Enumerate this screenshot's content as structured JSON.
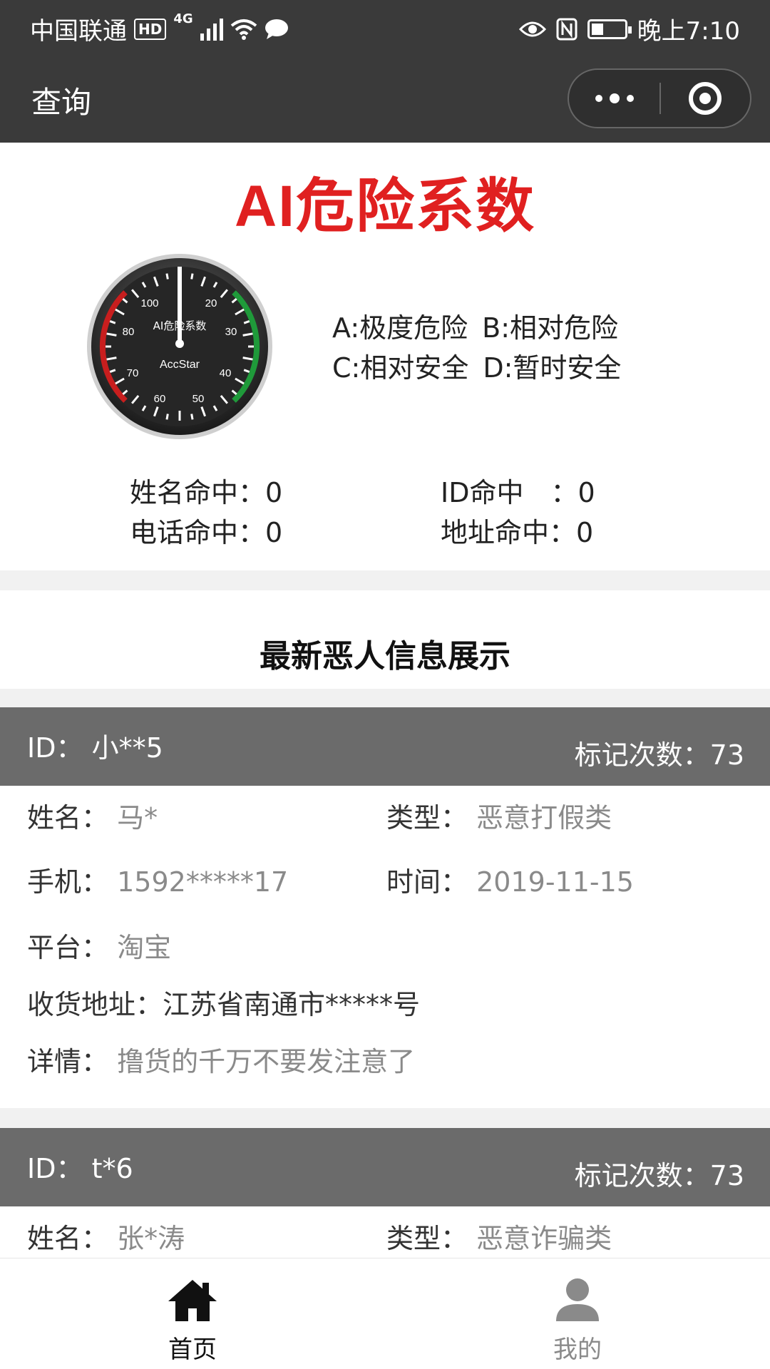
{
  "status": {
    "carrier": "中国联通",
    "hd": "HD",
    "network": "4G",
    "time": "晚上7:10"
  },
  "nav": {
    "title": "查询"
  },
  "danger": {
    "title": "AI危险系数",
    "gauge": {
      "label_top": "AI危险系数",
      "label_bottom": "AccStar",
      "ticks": [
        "100",
        "20",
        "80",
        "30",
        "70",
        "40",
        "60",
        "50"
      ]
    },
    "legend": {
      "a": "A:极度危险",
      "b": "B:相对危险",
      "c": "C:相对安全",
      "d": "D:暂时安全"
    }
  },
  "hits": {
    "name": "姓名命中：0",
    "id": "ID命中　：0",
    "phone": "电话命中：0",
    "address": "地址命中：0"
  },
  "section_title": "最新恶人信息展示",
  "records": [
    {
      "id_label": "ID：",
      "id": "小**5",
      "count_label": "标记次数：",
      "count": "73",
      "name_label": "姓名：",
      "name": "马*",
      "type_label": "类型：",
      "type": "恶意打假类",
      "phone_label": "手机：",
      "phone": "1592*****17",
      "time_label": "时间：",
      "time": "2019-11-15",
      "platform_label": "平台：",
      "platform": "淘宝",
      "address_label": "收货地址：",
      "address": "江苏省南通市*****号",
      "detail_label": "详情：",
      "detail": "撸货的千万不要发注意了"
    },
    {
      "id_label": "ID：",
      "id": "t*6",
      "count_label": "标记次数：",
      "count": "73",
      "name_label": "姓名：",
      "name": "张*涛",
      "type_label": "类型：",
      "type": "恶意诈骗类"
    }
  ],
  "tabbar": {
    "home": "首页",
    "mine": "我的",
    "home_color": "#111111",
    "mine_color": "#8a8a8a"
  }
}
